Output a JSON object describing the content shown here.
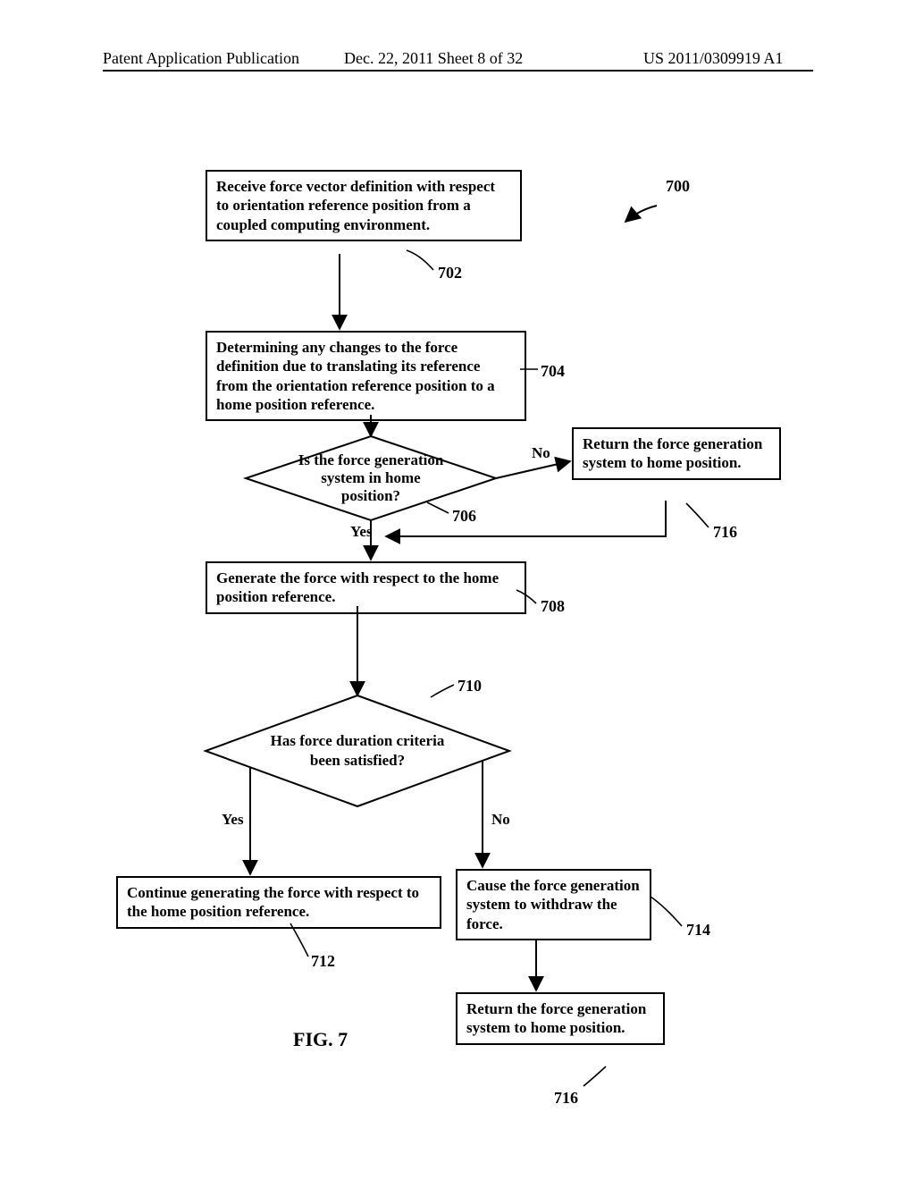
{
  "header": {
    "left": "Patent Application Publication",
    "mid": "Dec. 22, 2011 Sheet 8 of 32",
    "right": "US 2011/0309919 A1"
  },
  "boxes": {
    "b702": "Receive force vector definition with respect to orientation reference position from a coupled computing environment.",
    "b704": "Determining any changes to the force definition due to translating its reference from the orientation reference position to a home position reference.",
    "b708": "Generate the force with respect to the home position reference.",
    "b712": "Continue generating the force with respect to the home position reference.",
    "b714": "Cause the force generation system to withdraw the force.",
    "b716a": "Return the force generation system to home position.",
    "b716b": "Return the force generation system to home position."
  },
  "diamonds": {
    "d706_l1": "Is the force generation",
    "d706_l2": "system in home",
    "d706_l3": "position?",
    "d710_l1": "Has force duration criteria",
    "d710_l2": "been satisfied?"
  },
  "refs": {
    "r700": "700",
    "r702": "702",
    "r704": "704",
    "r706": "706",
    "r708": "708",
    "r710": "710",
    "r712": "712",
    "r714": "714",
    "r716a": "716",
    "r716b": "716"
  },
  "labels": {
    "no": "No",
    "yes": "Yes"
  },
  "figure": "FIG. 7"
}
